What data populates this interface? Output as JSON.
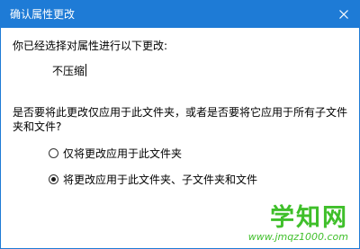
{
  "window": {
    "title": "确认属性更改"
  },
  "dialog": {
    "prompt": "你已经选择对属性进行以下更改:",
    "attribute_change": "不压缩",
    "question": "是否要将此更改仅应用于此文件夹，或者是否要将它应用于所有子文件夹和文件?",
    "options": [
      {
        "label": "仅将更改应用于此文件夹",
        "selected": false
      },
      {
        "label": "将更改应用于此文件夹、子文件夹和文件",
        "selected": true
      }
    ]
  },
  "watermark": {
    "main": "学知网",
    "sub": "www.jmqz1000.com"
  },
  "colors": {
    "titlebar": "#1e7bd6",
    "watermark": "#3fbf2a"
  }
}
